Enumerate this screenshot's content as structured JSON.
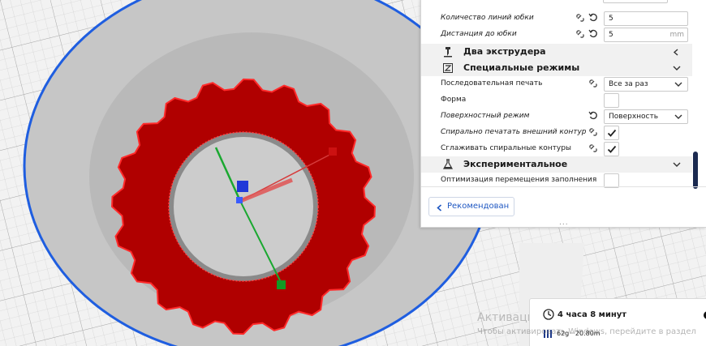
{
  "settings": {
    "skirt_line_count": {
      "label": "Количество линий юбки",
      "value": "5"
    },
    "skirt_distance": {
      "label": "Дистанция до юбки",
      "value": "5",
      "unit": "mm"
    },
    "category_dual_extruder": {
      "label": "Два экструдера",
      "icon": "dual-extruder-icon",
      "state": "collapsed"
    },
    "category_special_modes": {
      "label": "Специальные режимы",
      "icon": "special-modes-icon",
      "state": "expanded"
    },
    "print_sequence": {
      "label": "Последовательная печать",
      "value": "Все за раз"
    },
    "mold": {
      "label": "Форма",
      "checked": false
    },
    "surface_mode": {
      "label": "Поверхностный режим",
      "value": "Поверхность"
    },
    "spiralize": {
      "label": "Спирально печатать внешний контур",
      "checked": true
    },
    "smooth_spiral": {
      "label": "Сглаживать спиральные контуры",
      "checked": true
    },
    "category_experimental": {
      "label": "Экспериментальное",
      "icon": "experimental-flask-icon",
      "state": "expanded"
    },
    "infill_travel_optimization": {
      "label": "Оптимизация перемещения заполнения",
      "checked": false
    }
  },
  "recommended_button": {
    "label": "Рекомендован"
  },
  "print_info": {
    "time": "4 часа 8 минут",
    "material": "62g · 20.80m"
  },
  "watermark": {
    "title": "Активация Windows",
    "subtitle": "Чтобы активировать Windows, перейдите в раздел"
  },
  "colors": {
    "model": "#b00000",
    "model_outline": "#ff2a2a",
    "platform_border": "#1f5ee0",
    "accent": "#1e57c2",
    "scrollbar": "#1b2a50"
  }
}
